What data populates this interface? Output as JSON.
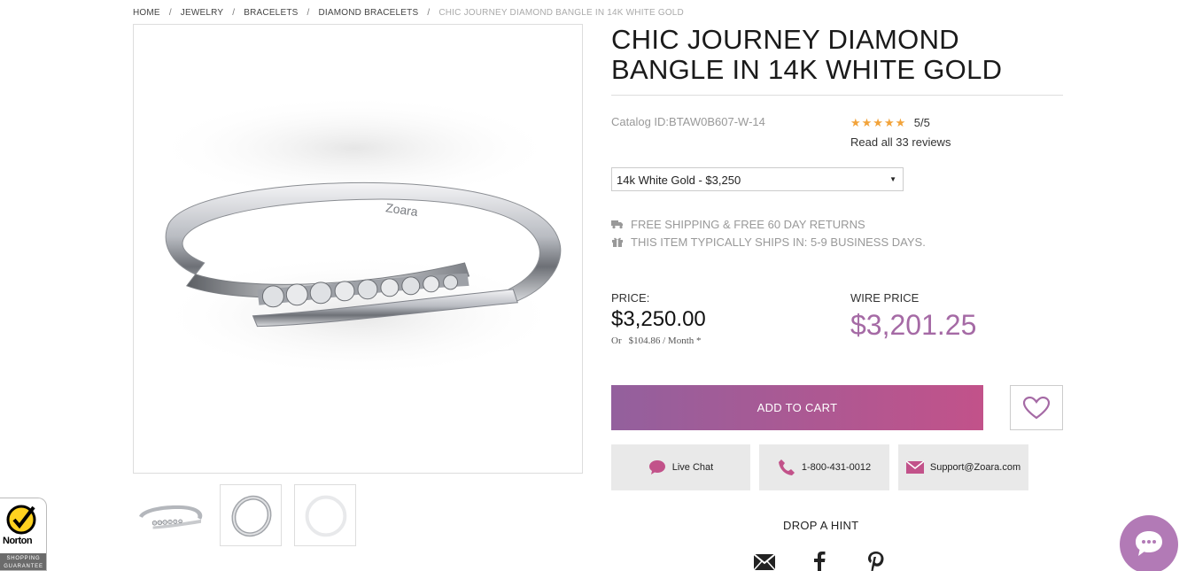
{
  "breadcrumb": {
    "items": [
      "HOME",
      "JEWELRY",
      "BRACELETS",
      "DIAMOND BRACELETS"
    ],
    "current": "CHIC JOURNEY DIAMOND BANGLE IN 14K WHITE GOLD",
    "separator": "/"
  },
  "product": {
    "title": "CHIC JOURNEY DIAMOND BANGLE IN 14K WHITE GOLD",
    "catalog_id": "Catalog ID:BTAW0B607-W-14",
    "rating": {
      "stars": "★★★★★",
      "score": "5/5",
      "reviews_link": "Read all 33 reviews"
    },
    "variant": {
      "selected": "14k White Gold - $3,250",
      "arrow": "▼"
    },
    "shipping": {
      "free_shipping": "FREE SHIPPING & FREE 60 DAY RETURNS",
      "ships_in": "THIS ITEM TYPICALLY SHIPS IN: 5-9 BUSINESS DAYS."
    },
    "price": {
      "label": "PRICE:",
      "value": "$3,250.00",
      "monthly_prefix": "Or",
      "monthly_amount": "$104.86 / Month *"
    },
    "wire_price": {
      "label": "WIRE PRICE",
      "value": "$3,201.25"
    },
    "image_brand_engraving": "Zoara"
  },
  "actions": {
    "add_to_cart": "ADD TO CART",
    "wishlist_icon": "heart-icon"
  },
  "contact": {
    "live_chat": "Live Chat",
    "phone": "1-800-431-0012",
    "email": "Support@Zoara.com"
  },
  "drop_hint": {
    "title": "DROP A HINT",
    "icons": [
      "email-icon",
      "facebook-icon",
      "pinterest-icon"
    ]
  },
  "norton": {
    "brand": "Norton",
    "badge_text": "SHOPPING GUARANTEE"
  },
  "colors": {
    "accent_purple": "#a56aa5",
    "gradient_start": "#93609d",
    "gradient_end": "#c2528a",
    "star": "#f2a33a",
    "muted_text": "#999999"
  }
}
